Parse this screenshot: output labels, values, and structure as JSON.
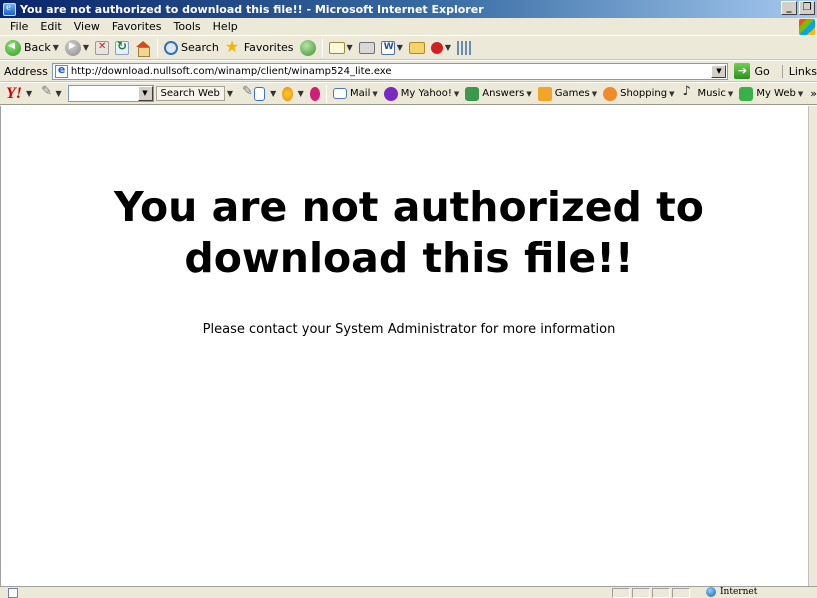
{
  "window": {
    "title": "You are not authorized to download this file!! - Microsoft Internet Explorer",
    "minimize_label": "_",
    "maximize_label": "❐"
  },
  "menubar": {
    "items": [
      "File",
      "Edit",
      "View",
      "Favorites",
      "Tools",
      "Help"
    ]
  },
  "toolbar": {
    "back_label": "Back",
    "search_label": "Search",
    "favorites_label": "Favorites"
  },
  "address": {
    "label": "Address",
    "url": "http://download.nullsoft.com/winamp/client/winamp524_lite.exe",
    "go_label": "Go",
    "links_label": "Links"
  },
  "yahoo_toolbar": {
    "logo": "Y!",
    "search_web_label": "Search Web",
    "search_value": "",
    "items": {
      "mail": "Mail",
      "my_yahoo": "My Yahoo!",
      "answers": "Answers",
      "games": "Games",
      "shopping": "Shopping",
      "music": "Music",
      "my_web": "My Web"
    },
    "overflow": "»"
  },
  "page": {
    "heading": "You are not authorized to download this file!!",
    "message": "Please contact your System Administrator for more information"
  },
  "statusbar": {
    "zone": "Internet"
  }
}
